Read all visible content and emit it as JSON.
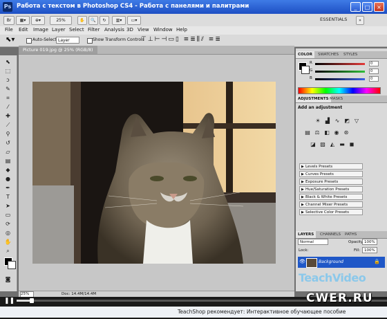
{
  "window": {
    "title": "Работа с текстом в Photoshop CS4 - Работа с панелями и палитрами",
    "app_badge": "Ps"
  },
  "app_bar": {
    "zoom": "25%",
    "workspace": "ESSENTIALS"
  },
  "menu": [
    "File",
    "Edit",
    "Image",
    "Layer",
    "Select",
    "Filter",
    "Analysis",
    "3D",
    "View",
    "Window",
    "Help"
  ],
  "options_bar": {
    "auto_select_label": "Auto-Select:",
    "auto_select_value": "Layer",
    "transform_label": "Show Transform Controls"
  },
  "document": {
    "tab_title": "Picture 019.jpg @ 25% (RGB/8)",
    "zoom": "25%",
    "doc_size": "Doc: 14.4M/14.4M"
  },
  "color_panel": {
    "tabs": [
      "COLOR",
      "SWATCHES",
      "STYLES"
    ],
    "channels": [
      {
        "label": "R",
        "value": "0",
        "color": "#e53a3a"
      },
      {
        "label": "G",
        "value": "0",
        "color": "#2fbf3a"
      },
      {
        "label": "B",
        "value": "0",
        "color": "#3a5fe5"
      }
    ]
  },
  "adjustments_panel": {
    "tabs": [
      "ADJUSTMENTS",
      "MASKS"
    ],
    "heading": "Add an adjustment",
    "presets": [
      "Levels Presets",
      "Curves Presets",
      "Exposure Presets",
      "Hue/Saturation Presets",
      "Black & White Presets",
      "Channel Mixer Presets",
      "Selective Color Presets"
    ]
  },
  "layers_panel": {
    "tabs": [
      "LAYERS",
      "CHANNELS",
      "PATHS"
    ],
    "blend_mode": "Normal",
    "opacity_label": "Opacity:",
    "opacity_value": "100%",
    "lock_label": "Lock:",
    "fill_label": "Fill:",
    "fill_value": "100%",
    "layer_name": "Background"
  },
  "player": {
    "ticker": "TeachShop рекомендует: Интерактивное обучающее пособие"
  },
  "watermarks": {
    "teachvideo": "TeachVideo",
    "cwer": "CWER.RU"
  },
  "colors": {
    "title_bar": "#2a5bd0",
    "selected_layer": "#1f57c7",
    "panel_bg": "#d9d9d9"
  }
}
